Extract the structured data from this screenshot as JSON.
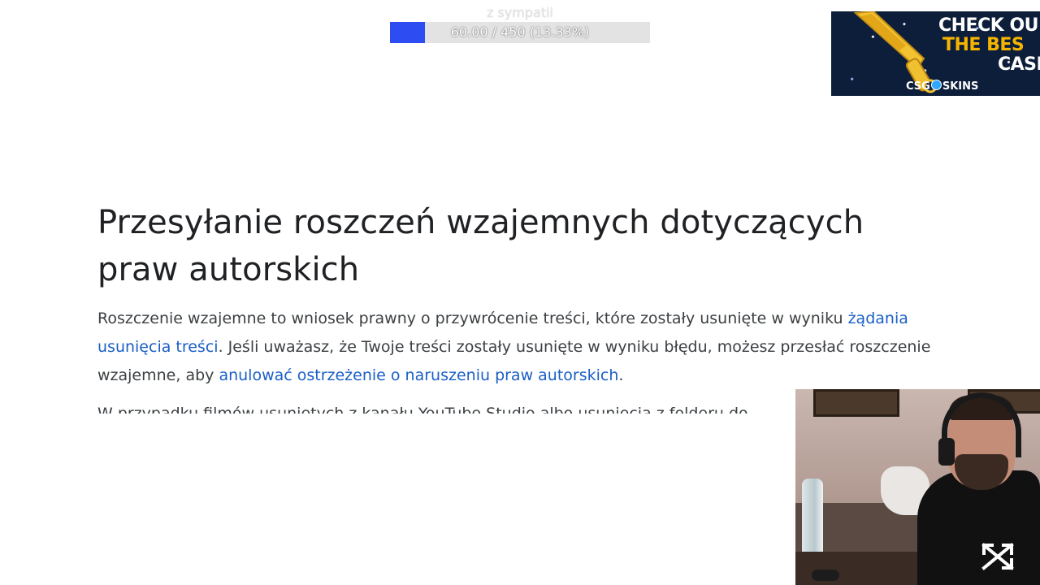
{
  "goal": {
    "title": "z sympatii",
    "progress_text": "60.00 / 450 (13.33%)",
    "current": 60.0,
    "target": 450,
    "percent": 13.33,
    "fill_color": "#2d4cf2",
    "track_color": "#e3e3e3"
  },
  "sponsor": {
    "line1": "CHECK OU",
    "line2": "THE BES",
    "line3": "CASE",
    "brand_left": "CSG",
    "brand_right": "SKINS",
    "accent_color": "#f5b400",
    "icon": "knife-icon"
  },
  "article": {
    "title": "Przesyłanie roszczeń wzajemnych dotyczących praw autorskich",
    "p1_text_a": "Roszczenie wzajemne to wniosek prawny o przywrócenie treści, które zostały usunięte w wyniku ",
    "p1_link_a": "żądania usunięcia treści",
    "p1_text_b": ". Jeśli uważasz, że Twoje treści zostały usunięte w wyniku błędu, możesz przesłać roszczenie wzajemne, aby ",
    "p1_link_b": "anulować ostrzeżenie o naruszeniu praw autorskich",
    "p1_text_c": ".",
    "p2_cut_text": "W przypadku filmów usuniętych z kanału YouTube Studio albo usunięcia z folderu do"
  },
  "colors": {
    "link": "#1a5fc6",
    "heading": "#202124",
    "body": "#3c4043"
  }
}
